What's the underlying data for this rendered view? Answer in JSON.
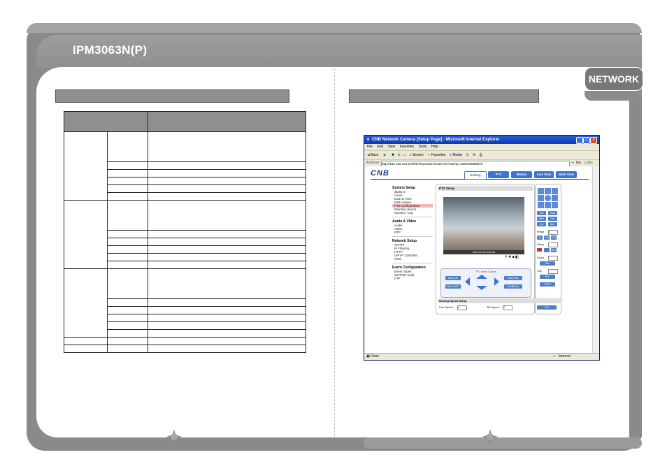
{
  "document": {
    "title": "IPM3063N(P)",
    "section_tab": "NETWORK"
  },
  "browser": {
    "window_title": "CNB Network Camera [Setup Page] - Microsoft Internet Explorer",
    "menu": [
      "File",
      "Edit",
      "View",
      "Favorites",
      "Tools",
      "Help"
    ],
    "toolbar": [
      "Back",
      "Search",
      "Favorites",
      "Media"
    ],
    "address_label": "Address",
    "address_value": "http://192.168.123.100/html/operator/Setup.htm?stamp=1260308885670",
    "go_label": "Go",
    "links_label": "Links",
    "status_left": "Done",
    "status_right": "Internet"
  },
  "camera_page": {
    "logo": "CNB",
    "tabs": [
      "Setting",
      "PTZ",
      "Motion",
      "Live View",
      "Multi View"
    ],
    "menu_groups": [
      {
        "heading": "System Setup",
        "items": [
          "3D2D.S",
          "Users",
          "Date & Time",
          "Multi Viewer",
          "PTZ Configuration",
          "Maintain Server",
          "System / Log"
        ]
      },
      {
        "heading": "Audio & Video",
        "items": [
          "Audio",
          "Video",
          "RTP"
        ]
      },
      {
        "heading": "Network Setup",
        "items": [
          "TCP/IP",
          "IP Filtering",
          "HTTP",
          "UPnP / DynDNS",
          "CMS"
        ]
      },
      {
        "heading": "Event Configuration",
        "items": [
          "Event Types",
          "SMTP(E-mail)",
          "FTP"
        ]
      }
    ],
    "selected_menu_item": "PTZ Configuration",
    "ptz_title": "PTZ Setup",
    "cam_timestamp": "2009-12-09 10:45:09",
    "control_label": "PTZ Menu Control",
    "ptz_buttons": [
      "Menu On",
      "Menu OFF",
      "Set(Enter)",
      "Esc(Back)"
    ],
    "right_buttons": [
      "Tele",
      "Wide",
      "Near",
      "Far",
      "Iris",
      "Iris -"
    ],
    "preset_label": "Preset",
    "preset_value": "1",
    "preset_buttons": [
      "Go",
      "Set",
      "Del"
    ],
    "swing_label": "Swing",
    "group_label": "Group",
    "tour_label": "Tour",
    "run_label": "Run",
    "stop_label": "STOP",
    "moving_speed_title": "Moving Speed Setup",
    "pan_speed_label": "Pan Speed :",
    "pan_speed_value": "4",
    "tilt_speed_label": "Tilt Speed :",
    "tilt_speed_value": "4",
    "set_label": "Set"
  },
  "colors": {
    "frame_gray": "#8a8a8a",
    "xp_blue": "#0b3bb0",
    "tab_blue": "#3b73d6",
    "highlight": "#f5b6b6"
  }
}
